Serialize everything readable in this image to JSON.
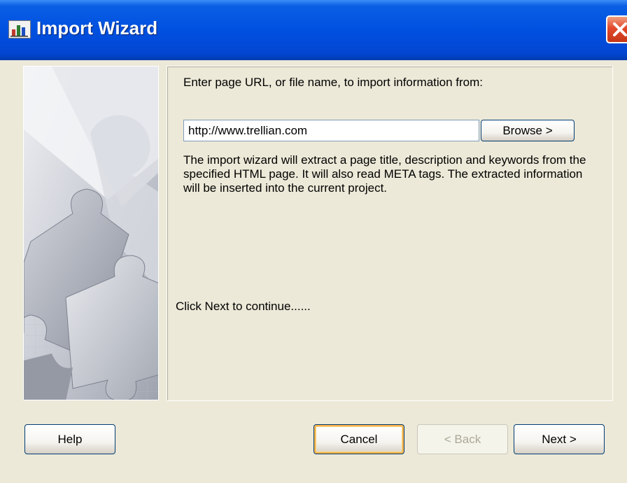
{
  "window": {
    "title": "Import Wizard",
    "title_icon": "chart-app-icon",
    "close_icon": "close-icon"
  },
  "content": {
    "prompt": "Enter page URL, or file name, to import information from:",
    "url_value": "http://www.trellian.com",
    "browse_label": "Browse >",
    "description": "The import wizard will extract a page title, description and keywords from the specified HTML page. It will also read META tags. The extracted information will be inserted into the current project.",
    "continue_text": "Click Next to continue......"
  },
  "buttons": {
    "help": "Help",
    "cancel": "Cancel",
    "back": "< Back",
    "next": "Next >"
  },
  "colors": {
    "titlebar": "#0050e0",
    "dialog_bg": "#ece9d8",
    "close_button": "#e2492a",
    "button_border": "#003c74",
    "default_button_highlight": "#f8b34a",
    "disabled_text": "#aca899"
  }
}
